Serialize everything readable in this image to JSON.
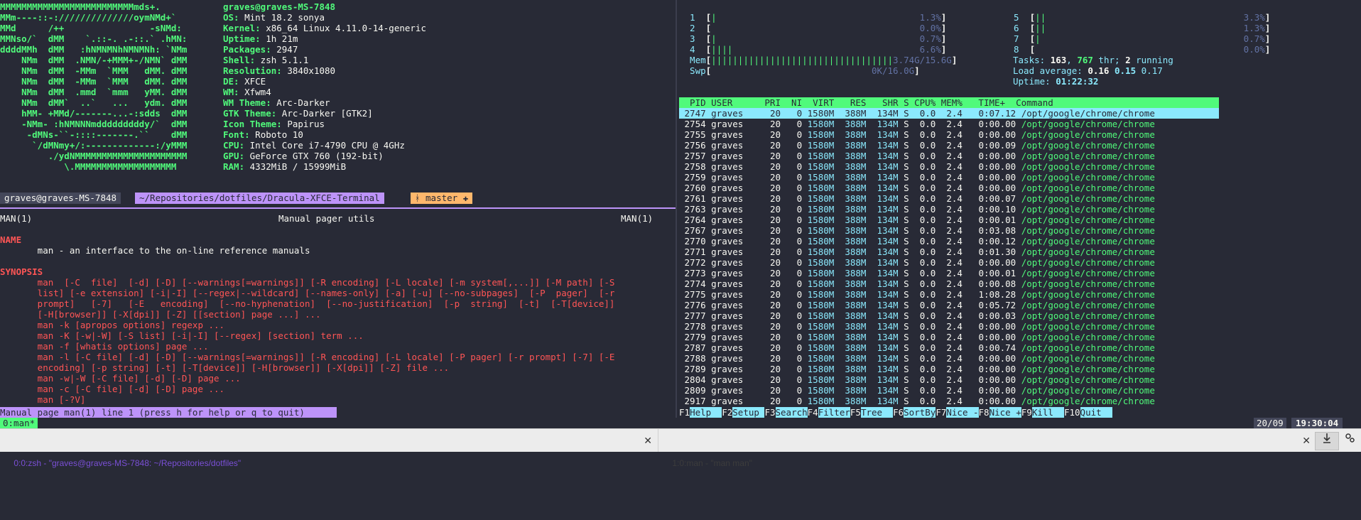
{
  "neofetch": {
    "art": [
      "MMMMMMMMMMMMMMMMMMMMMMMMMmds+.",
      "MMm----::-://////////////oymNMd+`",
      "MMd      /++                -sNMd:",
      "MMNso/`  dMM    `.::-. .-::.` .hMN:",
      "ddddMMh  dMM   :hNMNMNhNMNMNh: `NMm",
      "    NMm  dMM  .NMN/-+MMM+-/NMN` dMM",
      "    NMm  dMM  -MMm  `MMM   dMM. dMM",
      "    NMm  dMM  -MMm  `MMM   dMM. dMM",
      "    NMm  dMM  .mmd  `mmm   yMM. dMM",
      "    NMm  dMM`  ..`   ...   ydm. dMM",
      "    hMM- +MMd/-------...-:sdds  dMM",
      "    -NMm- :hNMNNNmdddddddddy/`  dMM",
      "     -dMNs-``-::::-------.``    dMM",
      "      `/dMNmy+/:-------------:/yMMM",
      "         ./ydNMMMMMMMMMMMMMMMMMMMMM",
      "            \\.MMMMMMMMMMMMMMMMMMM"
    ],
    "user_host": "graves@graves-MS-7848",
    "info": [
      {
        "key": "OS:",
        "value": " Mint 18.2 sonya"
      },
      {
        "key": "Kernel:",
        "value": " x86_64 Linux 4.11.0-14-generic"
      },
      {
        "key": "Uptime:",
        "value": " 1h 21m"
      },
      {
        "key": "Packages:",
        "value": " 2947"
      },
      {
        "key": "Shell:",
        "value": " zsh 5.1.1"
      },
      {
        "key": "Resolution:",
        "value": " 3840x1080"
      },
      {
        "key": "DE:",
        "value": " XFCE"
      },
      {
        "key": "WM:",
        "value": " Xfwm4"
      },
      {
        "key": "WM Theme:",
        "value": " Arc-Darker"
      },
      {
        "key": "GTK Theme:",
        "value": " Arc-Darker [GTK2]"
      },
      {
        "key": "Icon Theme:",
        "value": " Papirus"
      },
      {
        "key": "Font:",
        "value": " Roboto 10"
      },
      {
        "key": "CPU:",
        "value": " Intel Core i7-4790 CPU @ 4GHz"
      },
      {
        "key": "GPU:",
        "value": " GeForce GTX 760 (192-bit)"
      },
      {
        "key": "RAM:",
        "value": " 4332MiB / 15999MiB"
      }
    ]
  },
  "prompt": {
    "host": "graves@graves-MS-7848",
    "path": "~/Repositories/dotfiles/Dracula-XFCE-Terminal",
    "branch": "ᚼ master ✚"
  },
  "man": {
    "header_left": "MAN(1)",
    "header_center": "Manual pager utils",
    "header_right": "MAN(1)",
    "name_heading": "NAME",
    "name_text": "       man - an interface to the on-line reference manuals",
    "synopsis_heading": "SYNOPSIS",
    "synopsis_lines": [
      "       man  [-C  file]  [-d] [-D] [--warnings[=warnings]] [-R encoding] [-L locale] [-m system[,...]] [-M path] [-S",
      "       list] [-e extension] [-i|-I] [--regex|--wildcard] [--names-only] [-a] [-u] [--no-subpages]  [-P  pager]  [-r",
      "       prompt]   [-7]   [-E   encoding]  [--no-hyphenation]  [--no-justification]  [-p  string]  [-t]  [-T[device]]",
      "       [-H[browser]] [-X[dpi]] [-Z] [[section] page ...] ...",
      "       man -k [apropos options] regexp ...",
      "       man -K [-w|-W] [-S list] [-i|-I] [--regex] [section] term ...",
      "       man -f [whatis options] page ...",
      "       man -l [-C file] [-d] [-D] [--warnings[=warnings]] [-R encoding] [-L locale] [-P pager] [-r prompt] [-7] [-E",
      "       encoding] [-p string] [-t] [-T[device]] [-H[browser]] [-X[dpi]] [-Z] file ...",
      "       man -w|-W [-C file] [-d] [-D] page ...",
      "       man -c [-C file] [-d] [-D] page ...",
      "       man [-?V]"
    ],
    "status": "Manual page man(1) line 1 (press h for help or q to quit)"
  },
  "htop": {
    "cpus": [
      {
        "num": "1",
        "bar": "|",
        "pct": "1.3%"
      },
      {
        "num": "2",
        "bar": "",
        "pct": "0.0%"
      },
      {
        "num": "3",
        "bar": "|",
        "pct": "0.7%"
      },
      {
        "num": "4",
        "bar": "||||",
        "pct": "6.6%"
      },
      {
        "num": "5",
        "bar": "||",
        "pct": "3.3%"
      },
      {
        "num": "6",
        "bar": "||",
        "pct": "1.3%"
      },
      {
        "num": "7",
        "bar": "|",
        "pct": "0.7%"
      },
      {
        "num": "8",
        "bar": "",
        "pct": "0.0%"
      }
    ],
    "mem_label": "Mem",
    "mem_bar": "||||||||||||||||||||||||||||||||||",
    "mem_value": "3.74G/15.6G",
    "swp_label": "Swp",
    "swp_value": "0K/16.0G",
    "tasks_label": "Tasks: ",
    "tasks_count": "163",
    "threads": "767",
    "threads_label": " thr; ",
    "running": "2",
    "running_label": " running",
    "load_label": "Load average: ",
    "load1": "0.16",
    "load5": "0.15",
    "load15": "0.17",
    "uptime_label": "Uptime: ",
    "uptime": "01:22:32",
    "columns_header": "  PID USER      PRI  NI  VIRT   RES   SHR S CPU% MEM%   TIME+  Command",
    "processes": [
      {
        "pid": "2747",
        "user": "graves",
        "pri": "20",
        "ni": "0",
        "virt": "1580M",
        "res": "388M",
        "shr": "134M",
        "s": "S",
        "cpu": "0.0",
        "mem": "2.4",
        "time": "0:07.12",
        "cmd": "/opt/google/chrome/chrome"
      },
      {
        "pid": "2754",
        "user": "graves",
        "pri": "20",
        "ni": "0",
        "virt": "1580M",
        "res": "388M",
        "shr": "134M",
        "s": "S",
        "cpu": "0.0",
        "mem": "2.4",
        "time": "0:00.00",
        "cmd": "/opt/google/chrome/chrome"
      },
      {
        "pid": "2755",
        "user": "graves",
        "pri": "20",
        "ni": "0",
        "virt": "1580M",
        "res": "388M",
        "shr": "134M",
        "s": "S",
        "cpu": "0.0",
        "mem": "2.4",
        "time": "0:00.00",
        "cmd": "/opt/google/chrome/chrome"
      },
      {
        "pid": "2756",
        "user": "graves",
        "pri": "20",
        "ni": "0",
        "virt": "1580M",
        "res": "388M",
        "shr": "134M",
        "s": "S",
        "cpu": "0.0",
        "mem": "2.4",
        "time": "0:00.09",
        "cmd": "/opt/google/chrome/chrome"
      },
      {
        "pid": "2757",
        "user": "graves",
        "pri": "20",
        "ni": "0",
        "virt": "1580M",
        "res": "388M",
        "shr": "134M",
        "s": "S",
        "cpu": "0.0",
        "mem": "2.4",
        "time": "0:00.00",
        "cmd": "/opt/google/chrome/chrome"
      },
      {
        "pid": "2758",
        "user": "graves",
        "pri": "20",
        "ni": "0",
        "virt": "1580M",
        "res": "388M",
        "shr": "134M",
        "s": "S",
        "cpu": "0.0",
        "mem": "2.4",
        "time": "0:00.00",
        "cmd": "/opt/google/chrome/chrome"
      },
      {
        "pid": "2759",
        "user": "graves",
        "pri": "20",
        "ni": "0",
        "virt": "1580M",
        "res": "388M",
        "shr": "134M",
        "s": "S",
        "cpu": "0.0",
        "mem": "2.4",
        "time": "0:00.00",
        "cmd": "/opt/google/chrome/chrome"
      },
      {
        "pid": "2760",
        "user": "graves",
        "pri": "20",
        "ni": "0",
        "virt": "1580M",
        "res": "388M",
        "shr": "134M",
        "s": "S",
        "cpu": "0.0",
        "mem": "2.4",
        "time": "0:00.00",
        "cmd": "/opt/google/chrome/chrome"
      },
      {
        "pid": "2761",
        "user": "graves",
        "pri": "20",
        "ni": "0",
        "virt": "1580M",
        "res": "388M",
        "shr": "134M",
        "s": "S",
        "cpu": "0.0",
        "mem": "2.4",
        "time": "0:00.07",
        "cmd": "/opt/google/chrome/chrome"
      },
      {
        "pid": "2763",
        "user": "graves",
        "pri": "20",
        "ni": "0",
        "virt": "1580M",
        "res": "388M",
        "shr": "134M",
        "s": "S",
        "cpu": "0.0",
        "mem": "2.4",
        "time": "0:00.10",
        "cmd": "/opt/google/chrome/chrome"
      },
      {
        "pid": "2764",
        "user": "graves",
        "pri": "20",
        "ni": "0",
        "virt": "1580M",
        "res": "388M",
        "shr": "134M",
        "s": "S",
        "cpu": "0.0",
        "mem": "2.4",
        "time": "0:00.01",
        "cmd": "/opt/google/chrome/chrome"
      },
      {
        "pid": "2767",
        "user": "graves",
        "pri": "20",
        "ni": "0",
        "virt": "1580M",
        "res": "388M",
        "shr": "134M",
        "s": "S",
        "cpu": "0.0",
        "mem": "2.4",
        "time": "0:03.08",
        "cmd": "/opt/google/chrome/chrome"
      },
      {
        "pid": "2770",
        "user": "graves",
        "pri": "20",
        "ni": "0",
        "virt": "1580M",
        "res": "388M",
        "shr": "134M",
        "s": "S",
        "cpu": "0.0",
        "mem": "2.4",
        "time": "0:00.12",
        "cmd": "/opt/google/chrome/chrome"
      },
      {
        "pid": "2771",
        "user": "graves",
        "pri": "20",
        "ni": "0",
        "virt": "1580M",
        "res": "388M",
        "shr": "134M",
        "s": "S",
        "cpu": "0.0",
        "mem": "2.4",
        "time": "0:01.30",
        "cmd": "/opt/google/chrome/chrome"
      },
      {
        "pid": "2772",
        "user": "graves",
        "pri": "20",
        "ni": "0",
        "virt": "1580M",
        "res": "388M",
        "shr": "134M",
        "s": "S",
        "cpu": "0.0",
        "mem": "2.4",
        "time": "0:00.00",
        "cmd": "/opt/google/chrome/chrome"
      },
      {
        "pid": "2773",
        "user": "graves",
        "pri": "20",
        "ni": "0",
        "virt": "1580M",
        "res": "388M",
        "shr": "134M",
        "s": "S",
        "cpu": "0.0",
        "mem": "2.4",
        "time": "0:00.01",
        "cmd": "/opt/google/chrome/chrome"
      },
      {
        "pid": "2774",
        "user": "graves",
        "pri": "20",
        "ni": "0",
        "virt": "1580M",
        "res": "388M",
        "shr": "134M",
        "s": "S",
        "cpu": "0.0",
        "mem": "2.4",
        "time": "0:00.08",
        "cmd": "/opt/google/chrome/chrome"
      },
      {
        "pid": "2775",
        "user": "graves",
        "pri": "20",
        "ni": "0",
        "virt": "1580M",
        "res": "388M",
        "shr": "134M",
        "s": "S",
        "cpu": "0.0",
        "mem": "2.4",
        "time": "1:08.28",
        "cmd": "/opt/google/chrome/chrome"
      },
      {
        "pid": "2776",
        "user": "graves",
        "pri": "20",
        "ni": "0",
        "virt": "1580M",
        "res": "388M",
        "shr": "134M",
        "s": "S",
        "cpu": "0.0",
        "mem": "2.4",
        "time": "0:05.72",
        "cmd": "/opt/google/chrome/chrome"
      },
      {
        "pid": "2777",
        "user": "graves",
        "pri": "20",
        "ni": "0",
        "virt": "1580M",
        "res": "388M",
        "shr": "134M",
        "s": "S",
        "cpu": "0.0",
        "mem": "2.4",
        "time": "0:00.03",
        "cmd": "/opt/google/chrome/chrome"
      },
      {
        "pid": "2778",
        "user": "graves",
        "pri": "20",
        "ni": "0",
        "virt": "1580M",
        "res": "388M",
        "shr": "134M",
        "s": "S",
        "cpu": "0.0",
        "mem": "2.4",
        "time": "0:00.00",
        "cmd": "/opt/google/chrome/chrome"
      },
      {
        "pid": "2779",
        "user": "graves",
        "pri": "20",
        "ni": "0",
        "virt": "1580M",
        "res": "388M",
        "shr": "134M",
        "s": "S",
        "cpu": "0.0",
        "mem": "2.4",
        "time": "0:00.00",
        "cmd": "/opt/google/chrome/chrome"
      },
      {
        "pid": "2787",
        "user": "graves",
        "pri": "20",
        "ni": "0",
        "virt": "1580M",
        "res": "388M",
        "shr": "134M",
        "s": "S",
        "cpu": "0.0",
        "mem": "2.4",
        "time": "0:00.74",
        "cmd": "/opt/google/chrome/chrome"
      },
      {
        "pid": "2788",
        "user": "graves",
        "pri": "20",
        "ni": "0",
        "virt": "1580M",
        "res": "388M",
        "shr": "134M",
        "s": "S",
        "cpu": "0.0",
        "mem": "2.4",
        "time": "0:00.00",
        "cmd": "/opt/google/chrome/chrome"
      },
      {
        "pid": "2789",
        "user": "graves",
        "pri": "20",
        "ni": "0",
        "virt": "1580M",
        "res": "388M",
        "shr": "134M",
        "s": "S",
        "cpu": "0.0",
        "mem": "2.4",
        "time": "0:00.00",
        "cmd": "/opt/google/chrome/chrome"
      },
      {
        "pid": "2804",
        "user": "graves",
        "pri": "20",
        "ni": "0",
        "virt": "1580M",
        "res": "388M",
        "shr": "134M",
        "s": "S",
        "cpu": "0.0",
        "mem": "2.4",
        "time": "0:00.00",
        "cmd": "/opt/google/chrome/chrome"
      },
      {
        "pid": "2809",
        "user": "graves",
        "pri": "20",
        "ni": "0",
        "virt": "1580M",
        "res": "388M",
        "shr": "134M",
        "s": "S",
        "cpu": "0.0",
        "mem": "2.4",
        "time": "0:00.00",
        "cmd": "/opt/google/chrome/chrome"
      },
      {
        "pid": "2917",
        "user": "graves",
        "pri": "20",
        "ni": "0",
        "virt": "1580M",
        "res": "388M",
        "shr": "134M",
        "s": "S",
        "cpu": "0.0",
        "mem": "2.4",
        "time": "0:00.00",
        "cmd": "/opt/google/chrome/chrome"
      }
    ],
    "fkeys": [
      {
        "key": "F1",
        "label": "Help  "
      },
      {
        "key": "F2",
        "label": "Setup "
      },
      {
        "key": "F3",
        "label": "Search"
      },
      {
        "key": "F4",
        "label": "Filter"
      },
      {
        "key": "F5",
        "label": "Tree  "
      },
      {
        "key": "F6",
        "label": "SortBy"
      },
      {
        "key": "F7",
        "label": "Nice -"
      },
      {
        "key": "F8",
        "label": "Nice +"
      },
      {
        "key": "F9",
        "label": "Kill  "
      },
      {
        "key": "F10",
        "label": "Quit  "
      }
    ]
  },
  "tmux": {
    "window": "0:man*",
    "date": "20/09",
    "time": "19:30:04"
  },
  "taskbar": {
    "task1": "0:0:zsh - \"graves@graves-MS-7848: ~/Repositories/dotfiles\"",
    "task2": "1:0:man - \"man man\"",
    "close_glyph": "✕"
  }
}
